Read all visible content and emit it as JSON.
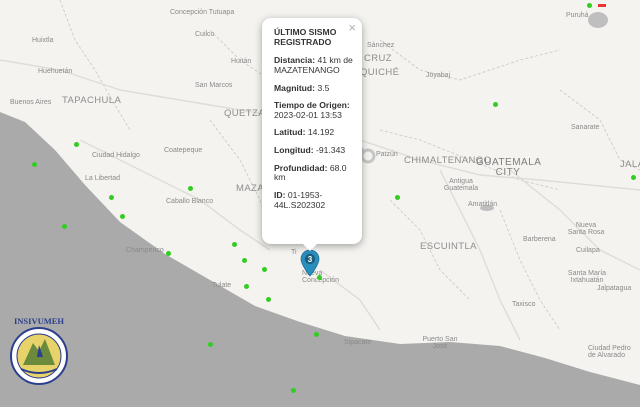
{
  "popup": {
    "title": "ÚLTIMO SISMO REGISTRADO",
    "close_glyph": "×",
    "fields": [
      {
        "label": "Distancia:",
        "value": "41 km de MAZATENANGO"
      },
      {
        "label": "Magnitud:",
        "value": "3.5"
      },
      {
        "label": "Tiempo de Origen:",
        "value": "2023-02-01 13:53"
      },
      {
        "label": "Latitud:",
        "value": "14.192"
      },
      {
        "label": "Longitud:",
        "value": "-91.343"
      },
      {
        "label": "Profundidad:",
        "value": "68.0 km"
      },
      {
        "label": "ID:",
        "value": "01-1953-44L.S202302"
      }
    ]
  },
  "marker": {
    "label": "3",
    "color": "#2a8fbd",
    "icon": "map-pin-icon"
  },
  "logo": {
    "text": "INSIVUMEH",
    "icon": "institution-seal-icon"
  },
  "colors": {
    "land": "#f4f3ef",
    "ocean": "#aaaaaa",
    "station": "#33cc22"
  },
  "labels": {
    "concepcion_tutuapa": "Concepción Tutuapa",
    "cuilco": "Cuilco",
    "huixtla": "Huixtla",
    "huehuetan": "Huehuetán",
    "buenos_aires": "Buenos Aires",
    "tapachula": "TAPACHULA",
    "ciudad_hidalgo": "Ciudad Hidalgo",
    "la_libertad": "La Libertad",
    "champerico": "Champerico",
    "tulate": "Tulate",
    "caballo_blanco": "Caballo Blanco",
    "coatepeque": "Coatepeque",
    "san_marcos": "San Marcos",
    "huitan": "Huitán",
    "quetza": "QUETZA",
    "maza": "MAZA",
    "quiche": "QUICHÉ",
    "cruz": "CRUZ",
    "sanchez": "Sánchez",
    "joyabaj": "Joyabaj",
    "sanarate": "Sanarate",
    "chimaltenango": "CHIMALTENANGO",
    "patzun": "Patzún",
    "guatemala_city": "GUATEMALA CITY",
    "antigua": "Antigua Guatemala",
    "amatitlan": "Amatitlán",
    "escuintla": "ESCUINTLA",
    "nueva_santa_rosa": "Nueva Santa Rosa",
    "barberena": "Barberena",
    "cuilapa": "Cuilapa",
    "santa_maria_ixtahuatan": "Santa María Ixtahuatán",
    "jalpatagua": "Jalpatagua",
    "taxisco": "Taxisco",
    "sipacate": "Sipacate",
    "puerto_san_jose": "Puerto San José",
    "ciudad_pedro": "Ciudad Pedro de Alvarado",
    "nueva_concepcion": "Nueva Concepción",
    "tiquisate": "Ti",
    "jalap": "JALAP",
    "puruha": "Puruhá"
  }
}
